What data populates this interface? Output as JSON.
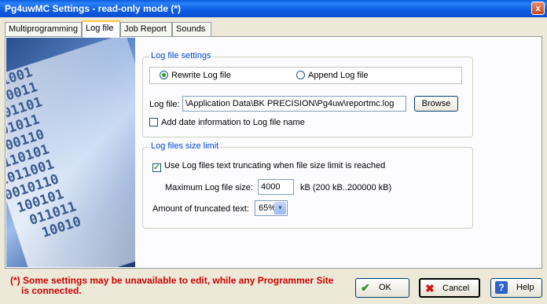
{
  "window": {
    "title": "Pg4uwMC Settings - read-only mode (*)",
    "close_glyph": "x"
  },
  "tabs": [
    {
      "label": "Multiprogramming"
    },
    {
      "label": "Log file"
    },
    {
      "label": "Job Report"
    },
    {
      "label": "Sounds"
    }
  ],
  "active_tab": "Log file",
  "banner": {
    "digits": "   01001\n  010011\n 1001101\n0101011\n1000110\n0110101\n1011001\n0010110\n 100101\n  011011\n   10010"
  },
  "log_settings": {
    "legend": "Log file settings",
    "rewrite_label": "Rewrite Log file",
    "append_label": "Append Log file",
    "selected": "Rewrite Log file",
    "logfile_label": "Log file:",
    "logfile_value": "\\Application Data\\BK PRECISION\\Pg4uw\\reportmc.log",
    "browse_label": "Browse",
    "add_date_label": "Add date information to Log file name",
    "add_date_checked": false
  },
  "size_limit": {
    "legend": "Log files size limit",
    "truncate_label": "Use Log files text truncating when file size limit is reached",
    "truncate_checked": true,
    "max_size_label": "Maximum Log file size:",
    "max_size_value": "4000",
    "max_size_unit": "kB  (200 kB..200000 kB)",
    "truncated_label": "Amount of truncated text:",
    "truncated_value": "65%"
  },
  "footer": {
    "warning_line1": "(*) Some settings may be unavailable to edit, while any Programmer Site",
    "warning_line2": "is connected.",
    "ok_label": "OK",
    "cancel_label": "Cancel",
    "help_label": "Help"
  },
  "colors": {
    "legend": "#0046d5",
    "warning": "#d00000",
    "title_bar": "#0a5de0"
  }
}
